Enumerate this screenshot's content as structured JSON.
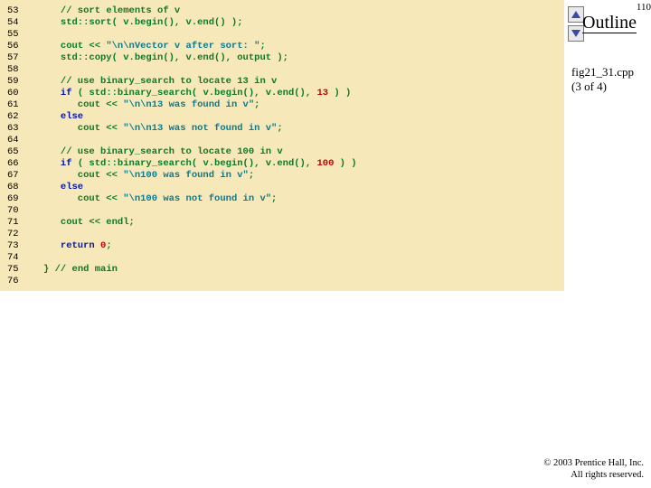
{
  "slide_number": "110",
  "outline_title": "Outline",
  "file_label": "fig21_31.cpp",
  "file_count": "(3 of 4)",
  "footer_line1": "© 2003 Prentice Hall, Inc.",
  "footer_line2": "All rights reserved.",
  "nav": {
    "up": "up",
    "down": "down"
  },
  "code": {
    "lines": [
      {
        "n": "53",
        "tokens": [
          {
            "t": "   ",
            "c": "default"
          },
          {
            "t": "// sort elements of v",
            "c": "comment"
          }
        ]
      },
      {
        "n": "54",
        "tokens": [
          {
            "t": "   std::sort( v.begin(), v.end() );",
            "c": "builtin"
          }
        ]
      },
      {
        "n": "55",
        "tokens": [
          {
            "t": "",
            "c": "default"
          }
        ]
      },
      {
        "n": "56",
        "tokens": [
          {
            "t": "   cout << ",
            "c": "builtin"
          },
          {
            "t": "\"\\n\\nVector v after sort: \"",
            "c": "string"
          },
          {
            "t": ";",
            "c": "builtin"
          }
        ]
      },
      {
        "n": "57",
        "tokens": [
          {
            "t": "   std::copy( v.begin(), v.end(), output );",
            "c": "builtin"
          }
        ]
      },
      {
        "n": "58",
        "tokens": [
          {
            "t": "",
            "c": "default"
          }
        ]
      },
      {
        "n": "59",
        "tokens": [
          {
            "t": "   ",
            "c": "default"
          },
          {
            "t": "// use binary_search to locate 13 in v",
            "c": "comment"
          }
        ]
      },
      {
        "n": "60",
        "tokens": [
          {
            "t": "   ",
            "c": "default"
          },
          {
            "t": "if",
            "c": "keyword"
          },
          {
            "t": " ( std::binary_search( v.begin(), v.end(), ",
            "c": "builtin"
          },
          {
            "t": "13",
            "c": "number"
          },
          {
            "t": " ) )",
            "c": "builtin"
          }
        ]
      },
      {
        "n": "61",
        "tokens": [
          {
            "t": "      cout << ",
            "c": "builtin"
          },
          {
            "t": "\"\\n\\n13 was found in v\"",
            "c": "string"
          },
          {
            "t": ";",
            "c": "builtin"
          }
        ]
      },
      {
        "n": "62",
        "tokens": [
          {
            "t": "   ",
            "c": "default"
          },
          {
            "t": "else",
            "c": "keyword"
          }
        ]
      },
      {
        "n": "63",
        "tokens": [
          {
            "t": "      cout << ",
            "c": "builtin"
          },
          {
            "t": "\"\\n\\n13 was not found in v\"",
            "c": "string"
          },
          {
            "t": ";",
            "c": "builtin"
          }
        ]
      },
      {
        "n": "64",
        "tokens": [
          {
            "t": "",
            "c": "default"
          }
        ]
      },
      {
        "n": "65",
        "tokens": [
          {
            "t": "   ",
            "c": "default"
          },
          {
            "t": "// use binary_search to locate 100 in v",
            "c": "comment"
          }
        ]
      },
      {
        "n": "66",
        "tokens": [
          {
            "t": "   ",
            "c": "default"
          },
          {
            "t": "if",
            "c": "keyword"
          },
          {
            "t": " ( std::binary_search( v.begin(), v.end(), ",
            "c": "builtin"
          },
          {
            "t": "100",
            "c": "number"
          },
          {
            "t": " ) )",
            "c": "builtin"
          }
        ]
      },
      {
        "n": "67",
        "tokens": [
          {
            "t": "      cout << ",
            "c": "builtin"
          },
          {
            "t": "\"\\n100 was found in v\"",
            "c": "string"
          },
          {
            "t": ";",
            "c": "builtin"
          }
        ]
      },
      {
        "n": "68",
        "tokens": [
          {
            "t": "   ",
            "c": "default"
          },
          {
            "t": "else",
            "c": "keyword"
          }
        ]
      },
      {
        "n": "69",
        "tokens": [
          {
            "t": "      cout << ",
            "c": "builtin"
          },
          {
            "t": "\"\\n100 was not found in v\"",
            "c": "string"
          },
          {
            "t": ";",
            "c": "builtin"
          }
        ]
      },
      {
        "n": "70",
        "tokens": [
          {
            "t": "",
            "c": "default"
          }
        ]
      },
      {
        "n": "71",
        "tokens": [
          {
            "t": "   cout << endl;",
            "c": "builtin"
          }
        ]
      },
      {
        "n": "72",
        "tokens": [
          {
            "t": "",
            "c": "default"
          }
        ]
      },
      {
        "n": "73",
        "tokens": [
          {
            "t": "   ",
            "c": "default"
          },
          {
            "t": "return",
            "c": "keyword"
          },
          {
            "t": " ",
            "c": "default"
          },
          {
            "t": "0",
            "c": "number"
          },
          {
            "t": ";",
            "c": "builtin"
          }
        ]
      },
      {
        "n": "74",
        "tokens": [
          {
            "t": "",
            "c": "default"
          }
        ]
      },
      {
        "n": "75",
        "tokens": [
          {
            "t": "} ",
            "c": "builtin"
          },
          {
            "t": "// end main",
            "c": "comment"
          }
        ]
      },
      {
        "n": "76",
        "tokens": [
          {
            "t": "",
            "c": "default"
          }
        ]
      }
    ]
  }
}
